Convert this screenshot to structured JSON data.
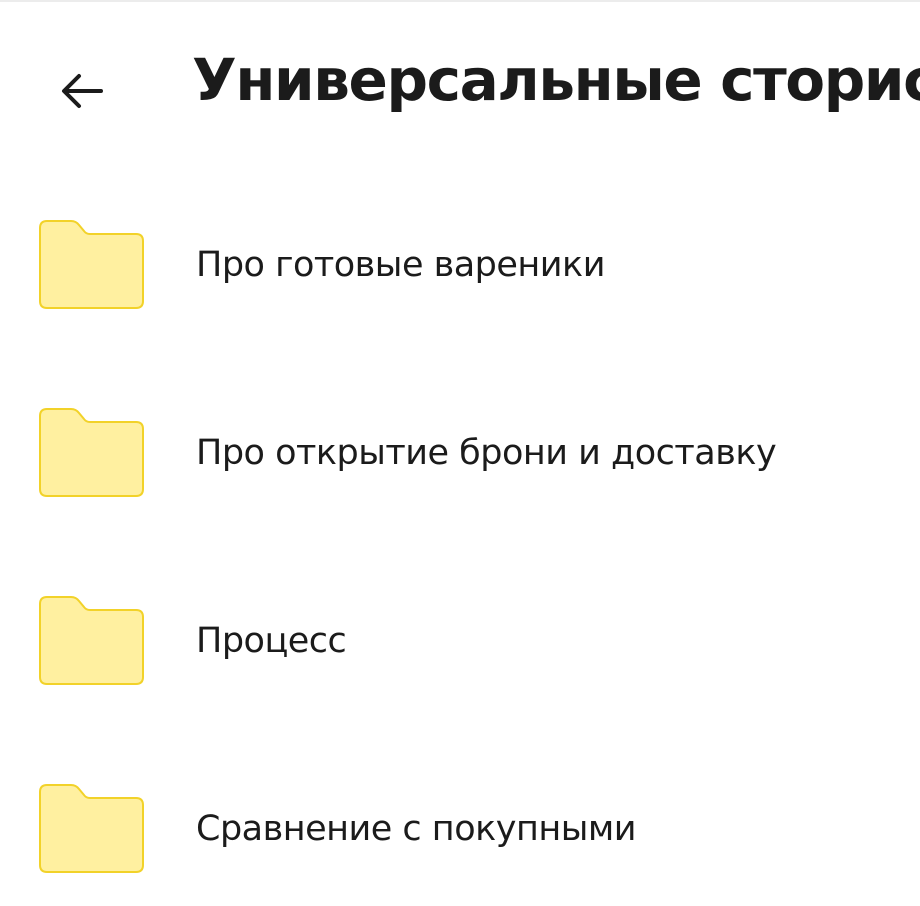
{
  "header": {
    "back_icon": "arrow-left-icon",
    "title": "Универсальные сторис"
  },
  "folders": [
    {
      "label": "Про готовые вареники",
      "icon": "folder-icon"
    },
    {
      "label": "Про открытие брони и доставку",
      "icon": "folder-icon"
    },
    {
      "label": "Процесс",
      "icon": "folder-icon"
    },
    {
      "label": "Сравнение с покупными",
      "icon": "folder-icon"
    }
  ],
  "colors": {
    "folder_fill": "#fff0a0",
    "folder_stroke": "#f2d229",
    "text": "#1b1b1b",
    "background": "#ffffff"
  }
}
